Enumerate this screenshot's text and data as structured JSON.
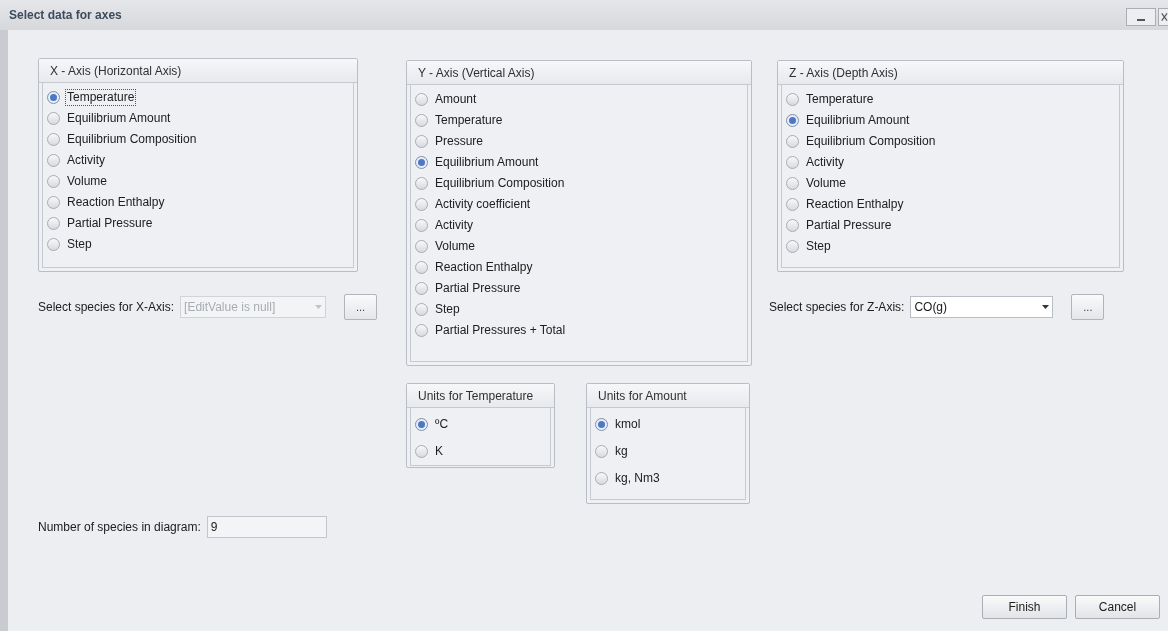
{
  "window": {
    "title": "Select data for axes"
  },
  "x_axis": {
    "title": "X - Axis (Horizontal Axis)",
    "options": [
      {
        "label": "Temperature",
        "selected": true,
        "focused": true
      },
      {
        "label": "Equilibrium Amount",
        "selected": false,
        "focused": false
      },
      {
        "label": "Equilibrium Composition",
        "selected": false,
        "focused": false
      },
      {
        "label": "Activity",
        "selected": false,
        "focused": false
      },
      {
        "label": "Volume",
        "selected": false,
        "focused": false
      },
      {
        "label": "Reaction Enthalpy",
        "selected": false,
        "focused": false
      },
      {
        "label": "Partial Pressure",
        "selected": false,
        "focused": false
      },
      {
        "label": "Step",
        "selected": false,
        "focused": false
      }
    ]
  },
  "x_species": {
    "label": "Select species for X-Axis:",
    "value": "[EditValue is null]",
    "disabled": true,
    "browse_button": "..."
  },
  "y_axis": {
    "title": "Y - Axis (Vertical Axis)",
    "options": [
      {
        "label": "Amount",
        "selected": false
      },
      {
        "label": "Temperature",
        "selected": false
      },
      {
        "label": "Pressure",
        "selected": false
      },
      {
        "label": "Equilibrium Amount",
        "selected": true
      },
      {
        "label": "Equilibrium Composition",
        "selected": false
      },
      {
        "label": "Activity coefficient",
        "selected": false
      },
      {
        "label": "Activity",
        "selected": false
      },
      {
        "label": "Volume",
        "selected": false
      },
      {
        "label": "Reaction Enthalpy",
        "selected": false
      },
      {
        "label": "Partial Pressure",
        "selected": false
      },
      {
        "label": "Step",
        "selected": false
      },
      {
        "label": "Partial Pressures + Total",
        "selected": false
      }
    ]
  },
  "units_temperature": {
    "title": "Units for Temperature",
    "options": [
      {
        "label": "ºC",
        "selected": true
      },
      {
        "label": "K",
        "selected": false
      }
    ]
  },
  "units_amount": {
    "title": "Units for Amount",
    "options": [
      {
        "label": "kmol",
        "selected": true
      },
      {
        "label": "kg",
        "selected": false
      },
      {
        "label": "kg, Nm3",
        "selected": false
      }
    ]
  },
  "z_axis": {
    "title": "Z - Axis (Depth Axis)",
    "options": [
      {
        "label": "Temperature",
        "selected": false
      },
      {
        "label": "Equilibrium Amount",
        "selected": true
      },
      {
        "label": "Equilibrium Composition",
        "selected": false
      },
      {
        "label": "Activity",
        "selected": false
      },
      {
        "label": "Volume",
        "selected": false
      },
      {
        "label": "Reaction Enthalpy",
        "selected": false
      },
      {
        "label": "Partial Pressure",
        "selected": false
      },
      {
        "label": "Step",
        "selected": false
      }
    ]
  },
  "z_species": {
    "label": "Select species for Z-Axis:",
    "value": "CO(g)",
    "disabled": false,
    "browse_button": "..."
  },
  "species_count": {
    "label": "Number of species in diagram:",
    "value": "9"
  },
  "buttons": [
    "Finish",
    "Cancel"
  ]
}
